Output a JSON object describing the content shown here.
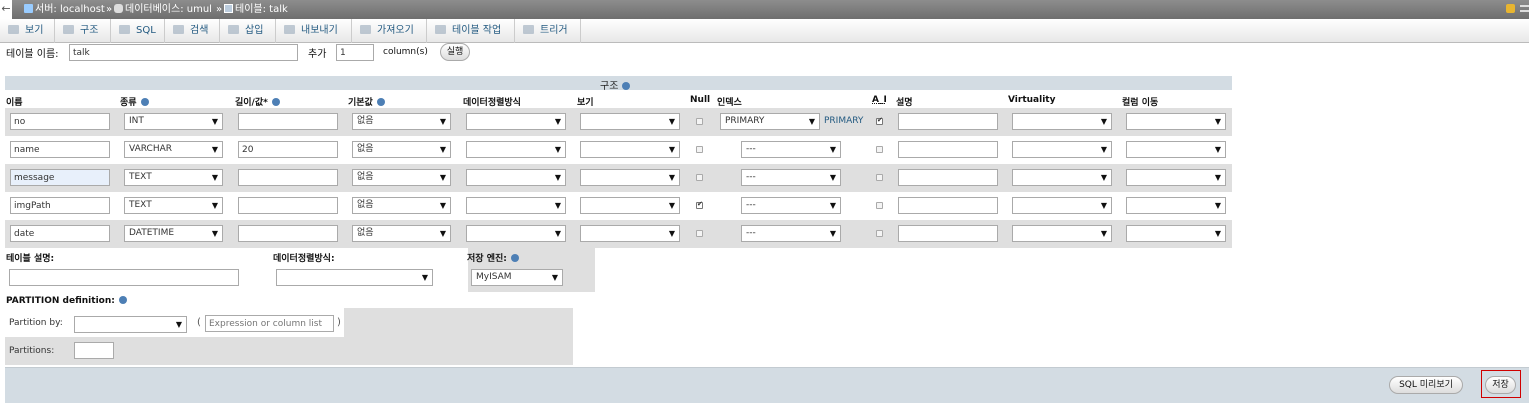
{
  "breadcrumb": {
    "server": "서버: localhost",
    "database": "데이터베이스: umul",
    "table": "테이블: talk",
    "sep": "»"
  },
  "tabs": [
    "보기",
    "구조",
    "SQL",
    "검색",
    "삽입",
    "내보내기",
    "가져오기",
    "테이블 작업",
    "트리거"
  ],
  "table_name": {
    "label": "테이블 이름:",
    "value": "talk",
    "add_label": "추가",
    "add_count": "1",
    "columns_label": "column(s)",
    "go_button": "실행"
  },
  "section_title": "구조",
  "headers": {
    "name": "이름",
    "type": "종류",
    "length": "길이/값*",
    "default": "기본값",
    "collation": "데이터정렬방식",
    "attributes": "보기",
    "null": "Null",
    "index": "인덱스",
    "ai": "A_I",
    "comment": "설명",
    "virtuality": "Virtuality",
    "move": "컬럼 이동"
  },
  "rows": [
    {
      "name": "no",
      "type": "INT",
      "length": "",
      "default": "없음",
      "null": false,
      "index": "PRIMARY",
      "index_label": "PRIMARY",
      "ai": true
    },
    {
      "name": "name",
      "type": "VARCHAR",
      "length": "20",
      "default": "없음",
      "null": false,
      "index": "---",
      "index_label": "",
      "ai": false
    },
    {
      "name": "message",
      "type": "TEXT",
      "length": "",
      "default": "없음",
      "null": false,
      "index": "---",
      "index_label": "",
      "ai": false
    },
    {
      "name": "imgPath",
      "type": "TEXT",
      "length": "",
      "default": "없음",
      "null": true,
      "index": "---",
      "index_label": "",
      "ai": false
    },
    {
      "name": "date",
      "type": "DATETIME",
      "length": "",
      "default": "없음",
      "null": false,
      "index": "---",
      "index_label": "",
      "ai": false
    }
  ],
  "table_options": {
    "comment_label": "테이블 설명:",
    "collation_label": "데이터정렬방식:",
    "engine_label": "저장 엔진:",
    "engine": "MyISAM"
  },
  "partition": {
    "title": "PARTITION definition:",
    "by_label": "Partition by:",
    "expr_placeholder": "Expression or column list",
    "paren_open": "(",
    "paren_close": ")",
    "partitions_label": "Partitions:"
  },
  "footer": {
    "preview_button": "SQL 미리보기",
    "save_button": "저장"
  },
  "colors": {
    "header_band": "#d3dce3",
    "row_band": "#dfdfdf",
    "save_highlight": "#d00000"
  }
}
